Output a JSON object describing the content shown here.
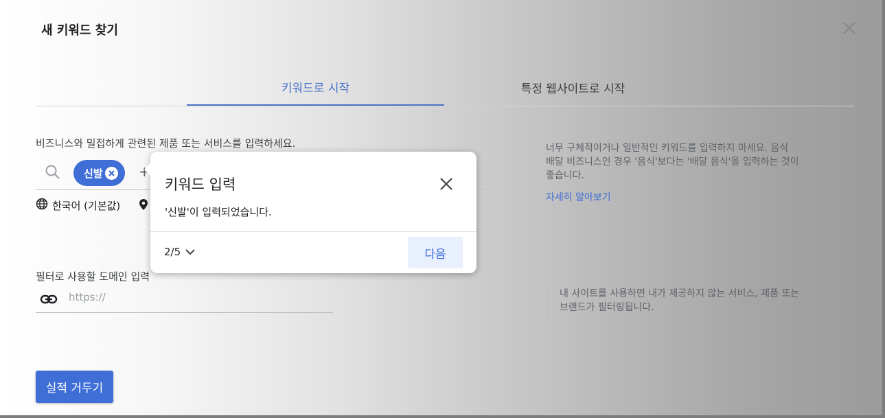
{
  "dialog": {
    "title": "새 키워드 찾기"
  },
  "tabs": [
    {
      "label": "키워드로 시작",
      "active": true
    },
    {
      "label": "특정 웹사이트로 시작",
      "active": false
    }
  ],
  "keywords": {
    "prompt": "비즈니스와 밀접하게 관련된 제품 또는 서비스를 입력하세요.",
    "chips": [
      "신발"
    ],
    "add_symbol": "+"
  },
  "settings": {
    "language": "한국어 (기본값)"
  },
  "hint_keywords": {
    "text_line1": "너무 구체적이거나 일반적인 키워드를 입력하지 마세요. 음식",
    "text_line2": "배달 비즈니스인 경우 '음식'보다는 '배달 음식'을 입력하는 것이",
    "text_line3": "좋습니다.",
    "link": "자세히 알아보기"
  },
  "domain": {
    "label": "필터로 사용할 도메인 입력",
    "placeholder": "https://"
  },
  "hint_domain": {
    "text_line1": "내 사이트를 사용하면 내가 제공하지 않는 서비스, 제품 또는",
    "text_line2": "브랜드가 필터링됩니다."
  },
  "submit_label": "실적 거두기",
  "popover": {
    "title": "키워드 입력",
    "body": "'신발'이 입력되었습니다.",
    "step": "2/5",
    "next_label": "다음"
  },
  "colors": {
    "accent": "#3e6ed6",
    "tab_active": "#4a73c9"
  },
  "icons": [
    "close-icon",
    "search-icon",
    "chip-remove-icon",
    "globe-icon",
    "location-pin-icon",
    "link-icon",
    "chevron-down-icon"
  ]
}
